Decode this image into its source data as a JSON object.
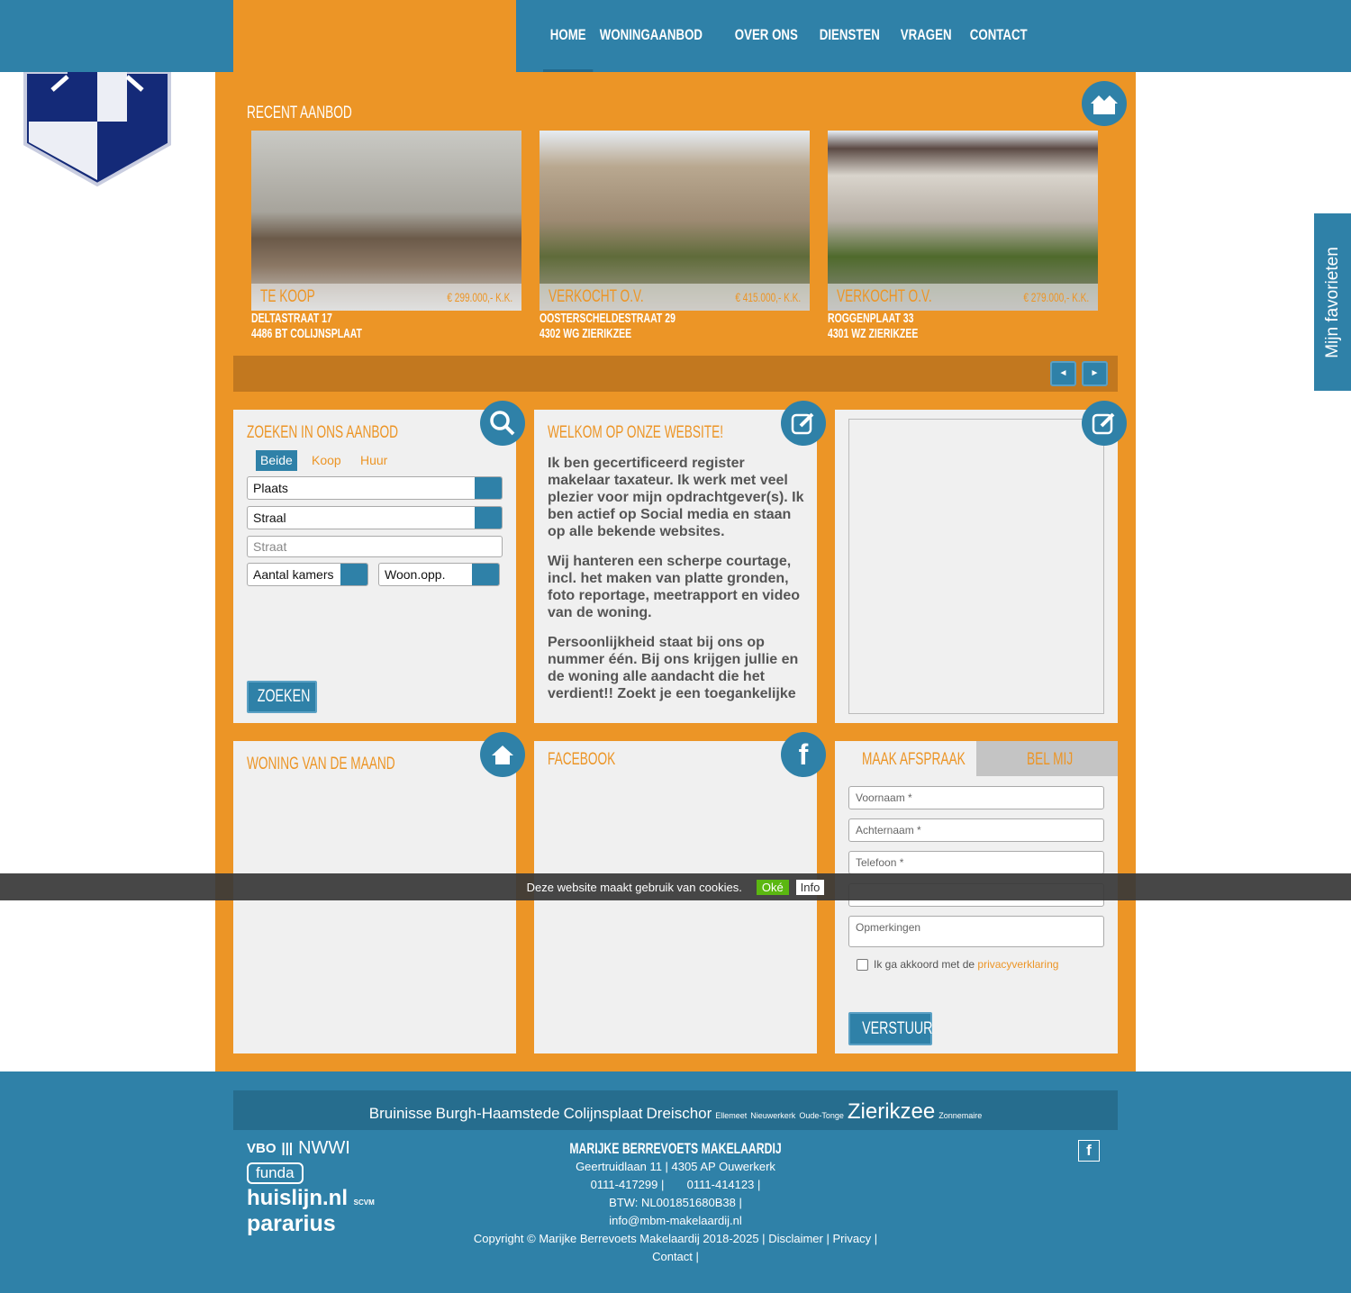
{
  "nav": {
    "items": [
      "HOME",
      "WONINGAANBOD",
      "OVER ONS",
      "DIENSTEN",
      "VRAGEN",
      "CONTACT"
    ],
    "active": "HOME"
  },
  "recent": {
    "title": "RECENT AANBOD",
    "properties": [
      {
        "status": "TE KOOP",
        "price": "€ 299.000,- K.K.",
        "street": "DELTASTRAAT 17",
        "city": "4486 BT COLIJNSPLAAT"
      },
      {
        "status": "VERKOCHT O.V.",
        "price": "€ 415.000,- K.K.",
        "street": "OOSTERSCHELDESTRAAT 29",
        "city": "4302 WG ZIERIKZEE"
      },
      {
        "status": "VERKOCHT O.V.",
        "price": "€ 279.000,- K.K.",
        "street": "ROGGENPLAAT 33",
        "city": "4301 WZ ZIERIKZEE"
      }
    ],
    "prev": "◄",
    "next": "►"
  },
  "search": {
    "title": "ZOEKEN IN ONS AANBOD",
    "tabs": [
      "Beide",
      "Koop",
      "Huur"
    ],
    "plaats": "Plaats",
    "straal": "Straal",
    "straat_placeholder": "Straat",
    "kamers": "Aantal kamers",
    "opp": "Woon.opp.",
    "button": "ZOEKEN"
  },
  "welcome": {
    "title": "WELKOM OP ONZE WEBSITE!",
    "paragraphs": [
      "Ik ben gecertificeerd register makelaar taxateur.  Ik werk met veel plezier voor mijn opdrachtgever(s). Ik ben actief op Social media en staan op alle bekende websites.",
      "Wij hanteren een scherpe courtage, incl. het maken van platte gronden, foto reportage, meetrapport en video van de woning.",
      "Persoonlijkheid staat bij ons op nummer één. Bij ons krijgen jullie en de woning alle aandacht die het verdient!! Zoekt je een toegankelijke"
    ]
  },
  "month": {
    "title": "WONING VAN DE MAAND"
  },
  "facebook": {
    "title": "FACEBOOK"
  },
  "form": {
    "tabs": [
      "MAAK AFSPRAAK",
      "BEL MIJ"
    ],
    "voornaam": "Voornaam *",
    "achternaam": "Achternaam *",
    "telefoon": "Telefoon *",
    "opmerkingen": "Opmerkingen",
    "agree": "Ik ga akkoord met de ",
    "privacy": "privacyverklaring",
    "button": "VERSTUUR"
  },
  "cookie": {
    "text": "Deze website maakt gebruik van cookies.",
    "ok": "Oké",
    "info": "Info"
  },
  "favorites": "Mijn favorieten",
  "footer": {
    "places": [
      {
        "name": "Bruinisse",
        "size": 17
      },
      {
        "name": "Burgh-Haamstede",
        "size": 17
      },
      {
        "name": "Colijnsplaat",
        "size": 17
      },
      {
        "name": "Dreischor",
        "size": 17
      },
      {
        "name": "Ellemeet",
        "size": 9
      },
      {
        "name": "Nieuwerkerk",
        "size": 9
      },
      {
        "name": "Oude-Tonge",
        "size": 9
      },
      {
        "name": "Zierikzee",
        "size": 24
      },
      {
        "name": "Zonnemaire",
        "size": 9
      }
    ],
    "company": "MARIJKE BERREVOETS MAKELAARDIJ",
    "address": "Geertruidlaan 11 | 4305 AP Ouwerkerk",
    "phone1": "0111-417299 |",
    "phone2": "0111-414123 |",
    "btw": "BTW: NL001851680B38 |",
    "email": "info@mbm-makelaardij.nl",
    "copyright": "Copyright © Marijke Berrevoets Makelaardij 2018-2025 |",
    "disclaimer": "Disclaimer",
    "privacy": "Privacy",
    "contact": "Contact",
    "logos": [
      "VBO",
      "NWWI",
      "funda",
      "huislijn.nl",
      "SCVM",
      "pararius"
    ]
  },
  "colors": {
    "primary": "#2f81a8",
    "accent": "#ec9526"
  }
}
